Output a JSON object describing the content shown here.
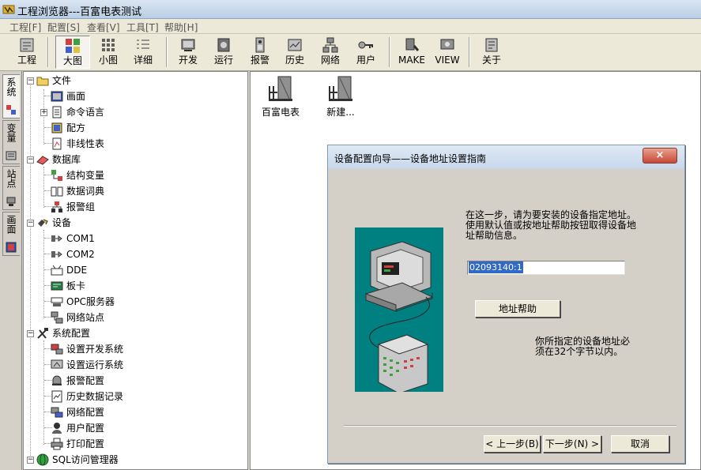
{
  "window": {
    "title": "工程浏览器---百富电表测试"
  },
  "menu": [
    "工程[F]",
    "配置[S]",
    "查看[V]",
    "工具[T]",
    "帮助[H]"
  ],
  "toolbar": [
    {
      "label": "工程",
      "icon": "project-icon"
    },
    {
      "label": "大图",
      "icon": "large-icons-icon",
      "pressed": true
    },
    {
      "label": "小图",
      "icon": "small-icons-icon"
    },
    {
      "label": "详细",
      "icon": "details-icon"
    },
    {
      "label": "开发",
      "icon": "develop-icon"
    },
    {
      "label": "运行",
      "icon": "run-icon"
    },
    {
      "label": "报警",
      "icon": "alarm-icon"
    },
    {
      "label": "历史",
      "icon": "history-icon"
    },
    {
      "label": "网络",
      "icon": "network-icon"
    },
    {
      "label": "用户",
      "icon": "user-key-icon"
    },
    {
      "label": "MAKE",
      "icon": "make-icon"
    },
    {
      "label": "VIEW",
      "icon": "view-icon"
    },
    {
      "label": "关于",
      "icon": "about-icon"
    }
  ],
  "side_tabs": [
    {
      "label": "系统",
      "active": true
    },
    {
      "label": "变量",
      "active": false
    },
    {
      "label": "站点",
      "active": false
    },
    {
      "label": "画面",
      "active": false
    }
  ],
  "tree": {
    "file": {
      "label": "文件",
      "children": [
        "画面",
        "命令语言",
        "配方",
        "非线性表"
      ]
    },
    "database": {
      "label": "数据库",
      "children": [
        "结构变量",
        "数据词典",
        "报警组"
      ]
    },
    "devices": {
      "label": "设备",
      "children": [
        "COM1",
        "COM2",
        "DDE",
        "板卡",
        "OPC服务器",
        "网络站点"
      ]
    },
    "sysconfig": {
      "label": "系统配置",
      "children": [
        "设置开发系统",
        "设置运行系统",
        "报警配置",
        "历史数据记录",
        "网络配置",
        "用户配置",
        "打印配置"
      ]
    },
    "sql": {
      "label": "SQL访问管理器"
    }
  },
  "main_items": [
    "百富电表",
    "新建..."
  ],
  "dialog": {
    "title": "设备配置向导——设备地址设置指南",
    "close": "×",
    "instructions": [
      "在这一步，请为要安装的设备指定地址。",
      "使用默认值或按地址帮助按钮取得设备地",
      "址帮助信息。"
    ],
    "address_value": "02093140:1",
    "help_button": "地址帮助",
    "note": [
      "你所指定的设备地址必",
      "须在32个字节以内。"
    ],
    "back_button": "< 上一步(B)",
    "next_button": "下一步(N) >",
    "cancel_button": "取消"
  }
}
